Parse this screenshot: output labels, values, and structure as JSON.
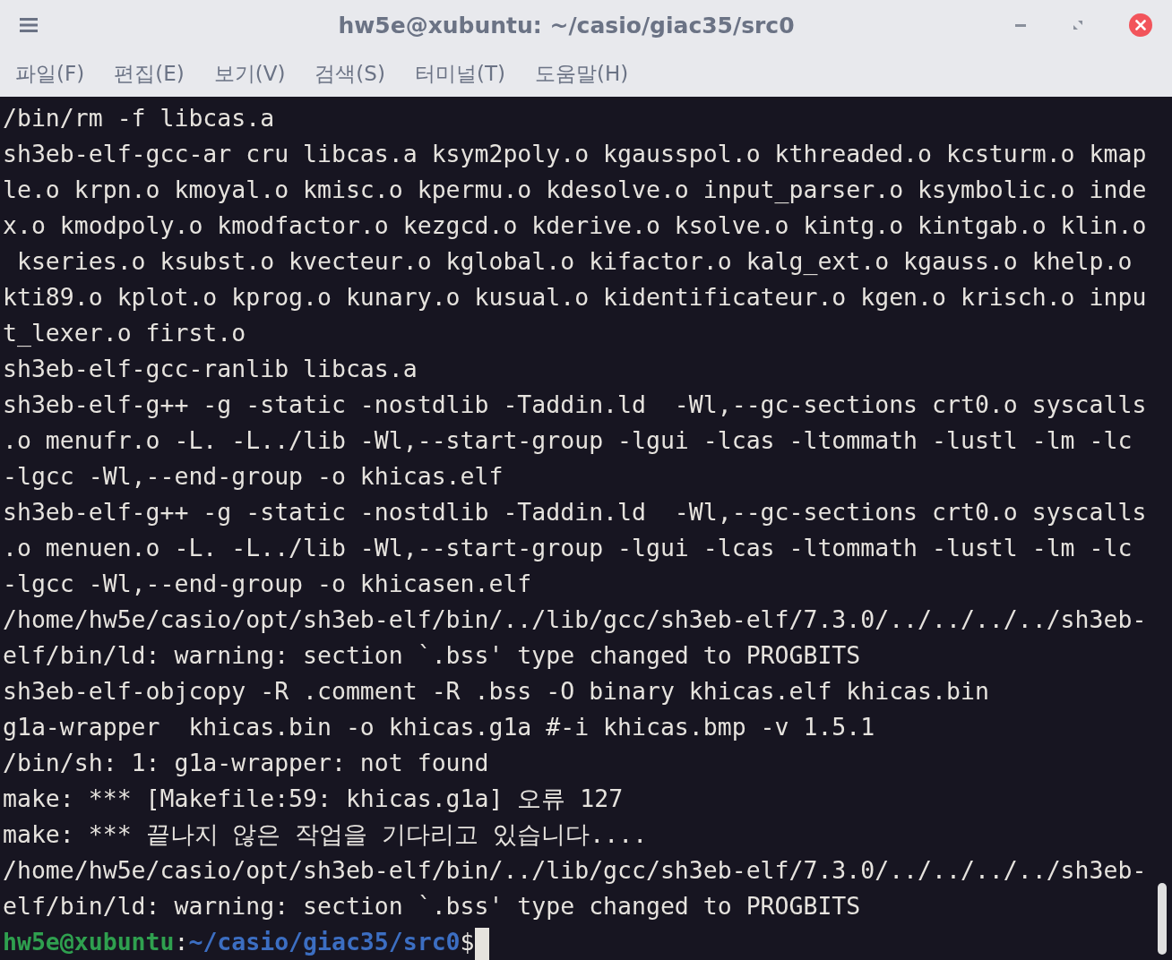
{
  "window": {
    "title": "hw5e@xubuntu: ~/casio/giac35/src0"
  },
  "menu": [
    "파일(F)",
    "편집(E)",
    "보기(V)",
    "검색(S)",
    "터미널(T)",
    "도움말(H)"
  ],
  "terminal": {
    "lines": [
      "/bin/rm -f libcas.a",
      "sh3eb-elf-gcc-ar cru libcas.a ksym2poly.o kgausspol.o kthreaded.o kcsturm.o kmap",
      "le.o krpn.o kmoyal.o kmisc.o kpermu.o kdesolve.o input_parser.o ksymbolic.o inde",
      "x.o kmodpoly.o kmodfactor.o kezgcd.o kderive.o ksolve.o kintg.o kintgab.o klin.o",
      " kseries.o ksubst.o kvecteur.o kglobal.o kifactor.o kalg_ext.o kgauss.o khelp.o",
      "kti89.o kplot.o kprog.o kunary.o kusual.o kidentificateur.o kgen.o krisch.o inpu",
      "t_lexer.o first.o",
      "sh3eb-elf-gcc-ranlib libcas.a",
      "sh3eb-elf-g++ -g -static -nostdlib -Taddin.ld  -Wl,--gc-sections crt0.o syscalls",
      ".o menufr.o -L. -L../lib -Wl,--start-group -lgui -lcas -ltommath -lustl -lm -lc",
      "-lgcc -Wl,--end-group -o khicas.elf",
      "sh3eb-elf-g++ -g -static -nostdlib -Taddin.ld  -Wl,--gc-sections crt0.o syscalls",
      ".o menuen.o -L. -L../lib -Wl,--start-group -lgui -lcas -ltommath -lustl -lm -lc",
      "-lgcc -Wl,--end-group -o khicasen.elf",
      "/home/hw5e/casio/opt/sh3eb-elf/bin/../lib/gcc/sh3eb-elf/7.3.0/../../../../sh3eb-",
      "elf/bin/ld: warning: section `.bss' type changed to PROGBITS",
      "sh3eb-elf-objcopy -R .comment -R .bss -O binary khicas.elf khicas.bin",
      "g1a-wrapper  khicas.bin -o khicas.g1a #-i khicas.bmp -v 1.5.1",
      "/bin/sh: 1: g1a-wrapper: not found",
      "make: *** [Makefile:59: khicas.g1a] 오류 127",
      "make: *** 끝나지 않은 작업을 기다리고 있습니다....",
      "/home/hw5e/casio/opt/sh3eb-elf/bin/../lib/gcc/sh3eb-elf/7.3.0/../../../../sh3eb-",
      "elf/bin/ld: warning: section `.bss' type changed to PROGBITS"
    ],
    "prompt": {
      "user_host": "hw5e@xubuntu",
      "separator": ":",
      "path": "~/casio/giac35/src0",
      "symbol": "$"
    }
  }
}
